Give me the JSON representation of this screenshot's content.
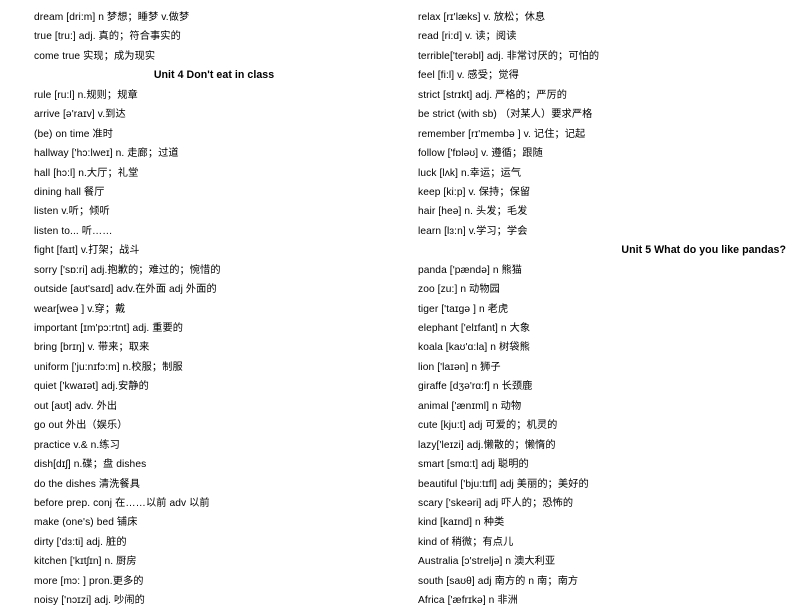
{
  "document": {
    "title": "English Vocabulary List — Units 4 and 5",
    "background_color": "#ffffff",
    "text_color": "#000000"
  },
  "left_column": {
    "lines": [
      {
        "type": "entry",
        "text": "dream [dri:m] n 梦想；睡梦 v.做梦"
      },
      {
        "type": "entry",
        "text": "true [tru:] adj. 真的；符合事实的"
      },
      {
        "type": "entry",
        "text": "come true 实现；成为现实"
      },
      {
        "type": "heading",
        "text": "Unit 4 Don't eat in class"
      },
      {
        "type": "entry",
        "text": "rule [ru:l] n.规则；规章"
      },
      {
        "type": "entry",
        "text": "arrive [ə'raɪv] v.到达"
      },
      {
        "type": "entry",
        "text": "(be) on time 准时"
      },
      {
        "type": "entry",
        "text": "hallway ['hɔ:lweɪ] n. 走廊；过道"
      },
      {
        "type": "entry",
        "text": "hall [hɔ:l] n.大厅；礼堂"
      },
      {
        "type": "entry",
        "text": "dining hall 餐厅"
      },
      {
        "type": "entry",
        "text": "listen   v.听；倾听"
      },
      {
        "type": "entry",
        "text": "listen to... 听……"
      },
      {
        "type": "entry",
        "text": "fight [faɪt] v.打架；战斗"
      },
      {
        "type": "entry",
        "text": "sorry ['sɒ:ri] adj.抱歉的；难过的；惋惜的"
      },
      {
        "type": "entry",
        "text": "outside [aʊt'saɪd] adv.在外面 adj 外面的"
      },
      {
        "type": "entry",
        "text": "wear[weə ] v.穿；戴"
      },
      {
        "type": "entry",
        "text": "important [ɪm'pɔ:rtnt] adj. 重要的"
      },
      {
        "type": "entry",
        "text": "bring [brɪŋ] v. 带来；取来"
      },
      {
        "type": "entry",
        "text": "uniform ['ju:nɪfɔ:m] n.校服；制服"
      },
      {
        "type": "entry",
        "text": "quiet ['kwaɪət] adj.安静的"
      },
      {
        "type": "entry",
        "text": "out [aʊt] adv. 外出"
      },
      {
        "type": "entry",
        "text": "go out 外出（娱乐）"
      },
      {
        "type": "entry",
        "text": "practice v.& n.练习"
      },
      {
        "type": "entry",
        "text": "dish[dɪʃ] n.碟；盘 dishes"
      },
      {
        "type": "entry",
        "text": "do the dishes 清洗餐具"
      },
      {
        "type": "entry",
        "text": "before prep. conj 在……以前  adv 以前"
      },
      {
        "type": "entry",
        "text": "make (one's) bed 铺床"
      },
      {
        "type": "entry",
        "text": "dirty ['dɜ:ti] adj. 脏的"
      },
      {
        "type": "entry",
        "text": "kitchen ['kɪtʃɪn] n. 厨房"
      },
      {
        "type": "entry",
        "text": "more [mɔ: ] pron.更多的"
      },
      {
        "type": "entry",
        "text": "noisy ['nɔɪzi] adj. 吵闹的"
      }
    ]
  },
  "right_column": {
    "lines": [
      {
        "type": "entry",
        "text": "relax [rɪ'læks] v. 放松；休息"
      },
      {
        "type": "entry",
        "text": "read [ri:d] v. 读；阅读"
      },
      {
        "type": "entry",
        "text": "terrible['terəbl] adj. 非常讨厌的；可怕的"
      },
      {
        "type": "entry",
        "text": "feel [fi:l] v. 感受；觉得"
      },
      {
        "type": "entry",
        "text": "strict [strɪkt] adj. 严格的；严厉的"
      },
      {
        "type": "entry",
        "text": "be strict (with sb)  （对某人）要求严格"
      },
      {
        "type": "entry",
        "text": "remember [rɪ'membə ] v. 记住；记起"
      },
      {
        "type": "entry",
        "text": "follow ['fɒləʊ] v. 遵循；跟随"
      },
      {
        "type": "entry",
        "text": "luck [lʌk] n.幸运；运气"
      },
      {
        "type": "entry",
        "text": "keep [ki:p] v. 保持；保留"
      },
      {
        "type": "entry",
        "text": "hair [heə] n. 头发；毛发"
      },
      {
        "type": "entry",
        "text": "learn [lɜ:n] v.学习；学会"
      },
      {
        "type": "heading",
        "text": "Unit 5 What do you like pandas?"
      },
      {
        "type": "entry",
        "text": "panda ['pændə] n 熊猫"
      },
      {
        "type": "entry",
        "text": "zoo [zu:] n 动物园"
      },
      {
        "type": "entry",
        "text": "tiger ['taɪgə ] n 老虎"
      },
      {
        "type": "entry",
        "text": "elephant ['elɪfant] n 大象"
      },
      {
        "type": "entry",
        "text": "koala [kaʊ'ɑ:la] n 树袋熊"
      },
      {
        "type": "entry",
        "text": "lion ['laɪən] n 狮子"
      },
      {
        "type": "entry",
        "text": "giraffe [dʒə'rɑ:f] n 长颈鹿"
      },
      {
        "type": "entry",
        "text": "animal ['ænɪml] n 动物"
      },
      {
        "type": "entry",
        "text": "cute [kju:t] adj 可爱的；机灵的"
      },
      {
        "type": "entry",
        "text": "lazy['leɪzi] adj.懒散的；懒惰的"
      },
      {
        "type": "entry",
        "text": "smart [smɑ:t] adj 聪明的"
      },
      {
        "type": "entry",
        "text": "beautiful ['bju:tɪfl] adj 美丽的；美好的"
      },
      {
        "type": "entry",
        "text": "scary ['skeəri] adj 吓人的；恐怖的"
      },
      {
        "type": "entry",
        "text": "kind [kaɪnd] n 种类"
      },
      {
        "type": "entry",
        "text": "kind of 稍微；有点儿"
      },
      {
        "type": "entry",
        "text": "Australia [ɔ'streljə] n 澳大利亚"
      },
      {
        "type": "entry",
        "text": "south [saʊθ] adj 南方的 n 南；南方"
      },
      {
        "type": "entry",
        "text": "Africa ['æfrɪkə] n 非洲"
      }
    ]
  }
}
